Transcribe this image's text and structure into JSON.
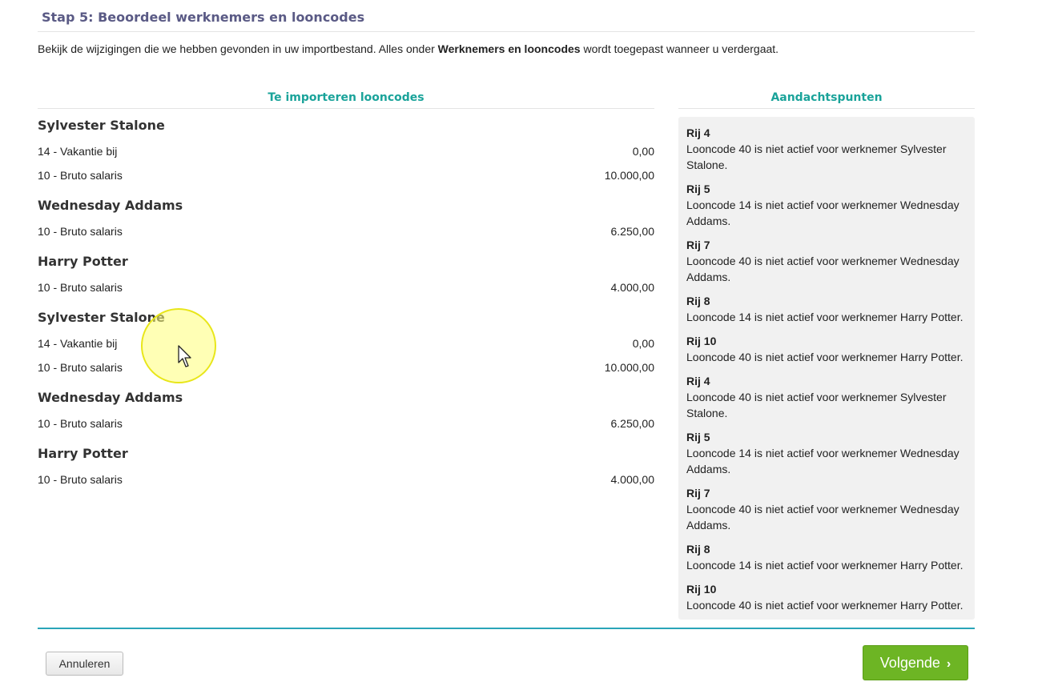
{
  "step_title": "Stap 5: Beoordeel werknemers en looncodes",
  "intro": {
    "before": "Bekijk de wijzigingen die we hebben gevonden in uw importbestand. Alles onder ",
    "bold": "Werknemers en looncodes",
    "after": " wordt toegepast wanneer u verdergaat."
  },
  "left_header": "Te importeren looncodes",
  "right_header": "Aandachtspunten",
  "employees": [
    {
      "name": "Sylvester Stalone",
      "codes": [
        {
          "label": "14 - Vakantie bij",
          "amount": "0,00"
        },
        {
          "label": "10 - Bruto salaris",
          "amount": "10.000,00"
        }
      ]
    },
    {
      "name": "Wednesday Addams",
      "codes": [
        {
          "label": "10 - Bruto salaris",
          "amount": "6.250,00"
        }
      ]
    },
    {
      "name": "Harry Potter",
      "codes": [
        {
          "label": "10 - Bruto salaris",
          "amount": "4.000,00"
        }
      ]
    },
    {
      "name": "Sylvester Stalone",
      "codes": [
        {
          "label": "14 - Vakantie bij",
          "amount": "0,00"
        },
        {
          "label": "10 - Bruto salaris",
          "amount": "10.000,00"
        }
      ]
    },
    {
      "name": "Wednesday Addams",
      "codes": [
        {
          "label": "10 - Bruto salaris",
          "amount": "6.250,00"
        }
      ]
    },
    {
      "name": "Harry Potter",
      "codes": [
        {
          "label": "10 - Bruto salaris",
          "amount": "4.000,00"
        }
      ]
    }
  ],
  "notes": [
    {
      "row": "Rij 4",
      "message": "Looncode 40 is niet actief voor werknemer Sylvester Stalone."
    },
    {
      "row": "Rij 5",
      "message": "Looncode 14 is niet actief voor werknemer Wednesday Addams."
    },
    {
      "row": "Rij 7",
      "message": "Looncode 40 is niet actief voor werknemer Wednesday Addams."
    },
    {
      "row": "Rij 8",
      "message": "Looncode 14 is niet actief voor werknemer Harry Potter."
    },
    {
      "row": "Rij 10",
      "message": "Looncode 40 is niet actief voor werknemer Harry Potter."
    },
    {
      "row": "Rij 4",
      "message": "Looncode 40 is niet actief voor werknemer Sylvester Stalone."
    },
    {
      "row": "Rij 5",
      "message": "Looncode 14 is niet actief voor werknemer Wednesday Addams."
    },
    {
      "row": "Rij 7",
      "message": "Looncode 40 is niet actief voor werknemer Wednesday Addams."
    },
    {
      "row": "Rij 8",
      "message": "Looncode 14 is niet actief voor werknemer Harry Potter."
    },
    {
      "row": "Rij 10",
      "message": "Looncode 40 is niet actief voor werknemer Harry Potter."
    }
  ],
  "buttons": {
    "cancel": "Annuleren",
    "next": "Volgende"
  },
  "icons": {
    "next": "chevron-right-icon",
    "cursor": "mouse-pointer-icon"
  },
  "colors": {
    "title": "#5a5a85",
    "header_teal": "#1aa39a",
    "rule_teal": "#2aa5b8",
    "next_green": "#6db524"
  }
}
